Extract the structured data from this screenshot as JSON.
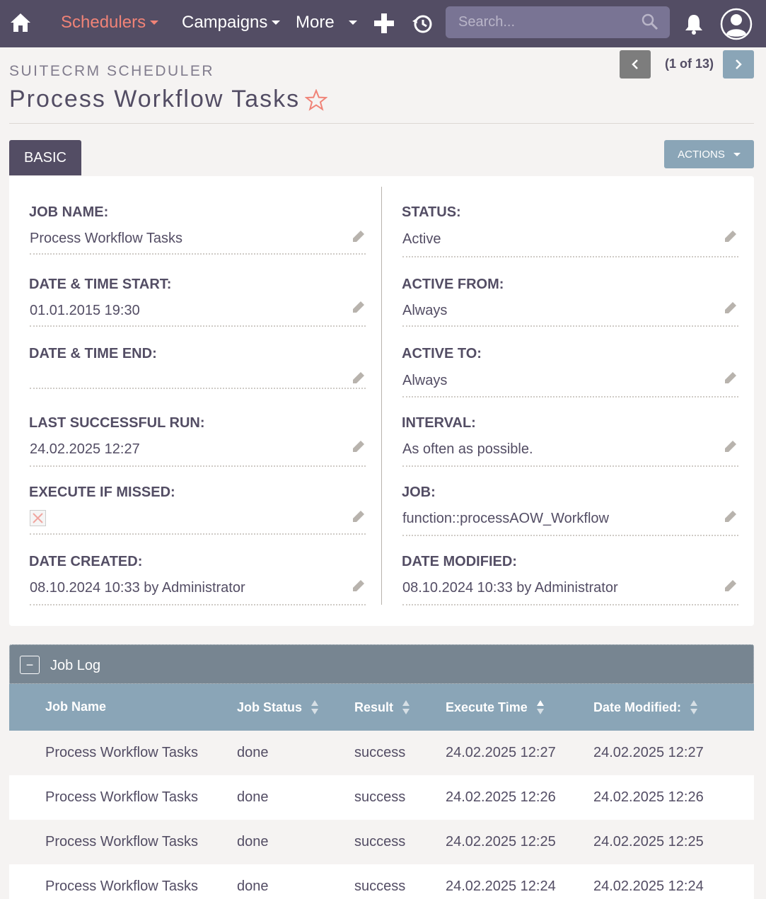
{
  "nav": {
    "menu": [
      {
        "label": "Schedulers",
        "active": true
      },
      {
        "label": "Campaigns",
        "active": false
      },
      {
        "label": "More",
        "active": false
      }
    ],
    "search_placeholder": "Search...",
    "icons": [
      "home-icon",
      "plus-icon",
      "history-icon",
      "search-icon",
      "bell-icon",
      "user-avatar-icon"
    ]
  },
  "header": {
    "module_name": "SUITECRM SCHEDULER",
    "title": "Process Workflow Tasks",
    "pager": "(1 of 13)"
  },
  "tabs": {
    "basic": "BASIC",
    "actions": "ACTIONS"
  },
  "fields": {
    "left": [
      {
        "label": "JOB NAME:",
        "value": "Process Workflow Tasks"
      },
      {
        "label": "DATE & TIME START:",
        "value": "01.01.2015 19:30"
      },
      {
        "label": "DATE & TIME END:",
        "value": ""
      },
      {
        "label": "LAST SUCCESSFUL RUN:",
        "value": "24.02.2025 12:27"
      },
      {
        "label": "EXECUTE IF MISSED:",
        "value": "",
        "checked": false
      },
      {
        "label": "DATE CREATED:",
        "value": "08.10.2024 10:33 by Administrator"
      }
    ],
    "right": [
      {
        "label": "STATUS:",
        "value": "Active"
      },
      {
        "label": "ACTIVE FROM:",
        "value": "Always"
      },
      {
        "label": "ACTIVE TO:",
        "value": "Always"
      },
      {
        "label": "INTERVAL:",
        "value": "As often as possible."
      },
      {
        "label": "JOB:",
        "value": "function::processAOW_Workflow"
      },
      {
        "label": "DATE MODIFIED:",
        "value": "08.10.2024 10:33 by Administrator"
      }
    ]
  },
  "job_log": {
    "title": "Job Log",
    "collapse_symbol": "−",
    "columns": [
      "Job Name",
      "Job Status",
      "Result",
      "Execute Time",
      "Date Modified:"
    ],
    "rows": [
      [
        "Process Workflow Tasks",
        "done",
        "success",
        "24.02.2025 12:27",
        "24.02.2025 12:27"
      ],
      [
        "Process Workflow Tasks",
        "done",
        "success",
        "24.02.2025 12:26",
        "24.02.2025 12:26"
      ],
      [
        "Process Workflow Tasks",
        "done",
        "success",
        "24.02.2025 12:25",
        "24.02.2025 12:25"
      ],
      [
        "Process Workflow Tasks",
        "done",
        "success",
        "24.02.2025 12:24",
        "24.02.2025 12:24"
      ]
    ]
  },
  "colors": {
    "nav_bg": "#534d64",
    "active_menu": "#f08377",
    "accent_blue": "#8aa5b7",
    "joblog_header": "#778591"
  }
}
